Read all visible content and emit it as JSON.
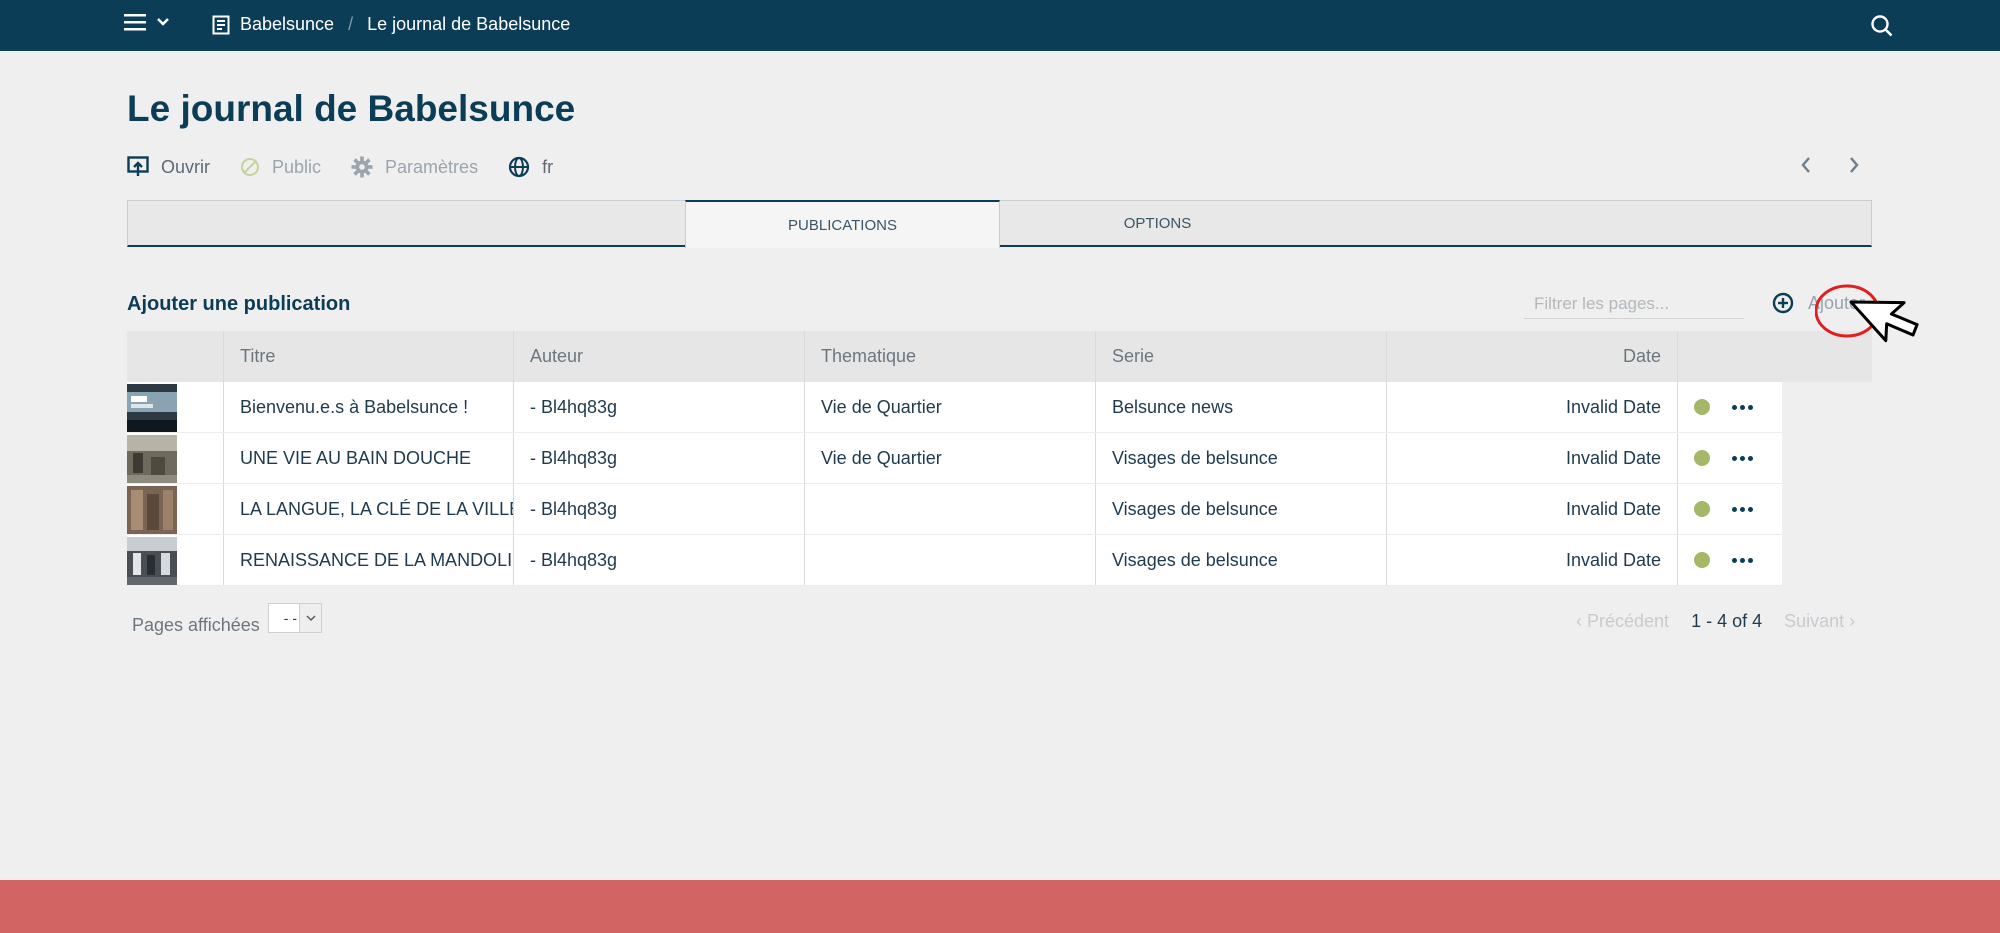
{
  "topbar": {
    "breadcrumb": [
      "Babelsunce",
      "Le journal de Babelsunce"
    ],
    "separator": "/"
  },
  "page": {
    "title": "Le journal de Babelsunce"
  },
  "actions": {
    "open": "Ouvrir",
    "public": "Public",
    "settings": "Paramètres",
    "language": "fr"
  },
  "tabs": {
    "publications": "PUBLICATIONS",
    "options": "OPTIONS"
  },
  "section": {
    "title": "Ajouter une publication",
    "filter_placeholder": "Filtrer les pages...",
    "add_label": "Ajouter"
  },
  "table": {
    "headers": [
      "Titre",
      "Auteur",
      "Thematique",
      "Serie",
      "Date"
    ],
    "rows": [
      {
        "title": "Bienvenu.e.s à Babelsunce !",
        "author": "- Bl4hq83g",
        "theme": "Vie de Quartier",
        "serie": "Belsunce news",
        "date": "Invalid Date"
      },
      {
        "title": "UNE VIE AU BAIN DOUCHE",
        "author": "- Bl4hq83g",
        "theme": "Vie de Quartier",
        "serie": "Visages de belsunce",
        "date": "Invalid Date"
      },
      {
        "title": "LA LANGUE, LA CLÉ DE LA VILLE...",
        "author": "- Bl4hq83g",
        "theme": "",
        "serie": "Visages de belsunce",
        "date": "Invalid Date"
      },
      {
        "title": "RENAISSANCE DE LA MANDOLINE",
        "author": "- Bl4hq83g",
        "theme": "",
        "serie": "Visages de belsunce",
        "date": "Invalid Date"
      }
    ]
  },
  "footer": {
    "pages_label": "Pages affichées",
    "pages_value": "- -",
    "prev": "Précédent",
    "count": "1 - 4 of 4",
    "next": "Suivant"
  },
  "colors": {
    "topbar": "#0c3d57",
    "accent_band": "#d26464",
    "status_dot": "#a5b868"
  }
}
